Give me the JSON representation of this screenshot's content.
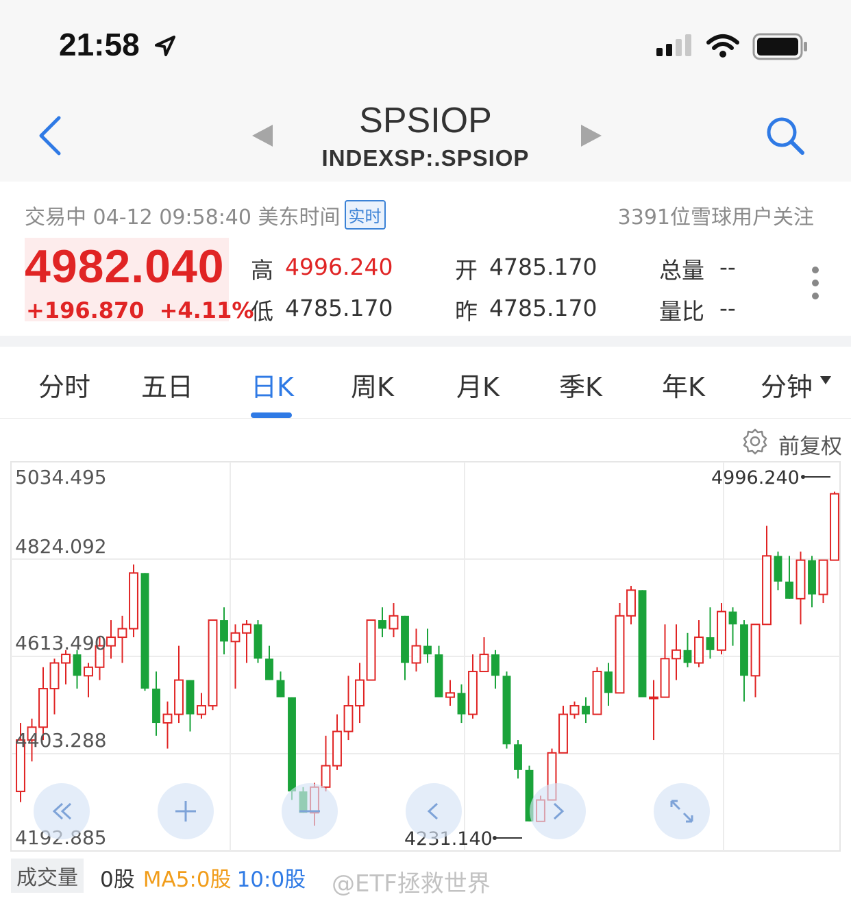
{
  "status_bar": {
    "time": "21:58"
  },
  "nav": {
    "title": "SPSIOP",
    "subtitle": "INDEXSP:.SPSIOP"
  },
  "quote": {
    "status": "交易中 04-12 09:58:40 美东时间",
    "realtime_badge": "实时",
    "followers": "3391位雪球用户关注",
    "price": "4982.040",
    "change": "+196.870",
    "change_pct": "+4.11%",
    "high_label": "高",
    "high": "4996.240",
    "low_label": "低",
    "low": "4785.170",
    "open_label": "开",
    "open": "4785.170",
    "prev_label": "昨",
    "prev_close": "4785.170",
    "volume_label": "总量",
    "volume": "--",
    "ratio_label": "量比",
    "ratio": "--",
    "price_color": "#e02424"
  },
  "tabs": {
    "items": [
      "分时",
      "五日",
      "日K",
      "周K",
      "月K",
      "季K",
      "年K",
      "分钟"
    ],
    "active": "日K"
  },
  "adjust_label": "前复权",
  "chart_data": {
    "type": "candlestick",
    "y_tick_labels": [
      "5034.495",
      "4824.092",
      "4613.490",
      "4403.288",
      "4192.885"
    ],
    "ylim": [
      4192.885,
      5034.495
    ],
    "max_label": "4996.240",
    "min_label": "4231.140",
    "up_color": "#e02424",
    "down_color": "#1aa33a",
    "candles": [
      [
        4300,
        4420,
        4275,
        4460
      ],
      [
        4420,
        4450,
        4370,
        4470
      ],
      [
        4450,
        4540,
        4420,
        4590
      ],
      [
        4540,
        4600,
        4480,
        4610
      ],
      [
        4600,
        4620,
        4550,
        4630
      ],
      [
        4620,
        4570,
        4540,
        4630
      ],
      [
        4570,
        4590,
        4520,
        4600
      ],
      [
        4590,
        4640,
        4560,
        4660
      ],
      [
        4640,
        4660,
        4610,
        4700
      ],
      [
        4660,
        4680,
        4600,
        4710
      ],
      [
        4680,
        4810,
        4660,
        4830
      ],
      [
        4810,
        4540,
        4535,
        4810
      ],
      [
        4540,
        4460,
        4430,
        4580
      ],
      [
        4460,
        4480,
        4400,
        4510
      ],
      [
        4480,
        4560,
        4460,
        4640
      ],
      [
        4560,
        4480,
        4440,
        4560
      ],
      [
        4480,
        4500,
        4470,
        4530
      ],
      [
        4500,
        4700,
        4490,
        4700
      ],
      [
        4700,
        4650,
        4620,
        4730
      ],
      [
        4650,
        4670,
        4540,
        4690
      ],
      [
        4670,
        4690,
        4600,
        4700
      ],
      [
        4690,
        4610,
        4600,
        4700
      ],
      [
        4610,
        4560,
        4560,
        4640
      ],
      [
        4560,
        4520,
        4520,
        4580
      ],
      [
        4520,
        4300,
        4280,
        4520
      ],
      [
        4300,
        4250,
        4250,
        4310
      ],
      [
        4250,
        4310,
        4220,
        4320
      ],
      [
        4310,
        4360,
        4300,
        4430
      ],
      [
        4360,
        4440,
        4350,
        4480
      ],
      [
        4440,
        4500,
        4420,
        4570
      ],
      [
        4500,
        4560,
        4460,
        4600
      ],
      [
        4560,
        4700,
        4560,
        4700
      ],
      [
        4700,
        4680,
        4660,
        4730
      ],
      [
        4680,
        4710,
        4660,
        4740
      ],
      [
        4710,
        4600,
        4560,
        4710
      ],
      [
        4600,
        4640,
        4580,
        4680
      ],
      [
        4640,
        4620,
        4600,
        4680
      ],
      [
        4620,
        4520,
        4520,
        4640
      ],
      [
        4520,
        4530,
        4500,
        4560
      ],
      [
        4530,
        4480,
        4460,
        4550
      ],
      [
        4480,
        4580,
        4470,
        4620
      ],
      [
        4580,
        4620,
        4580,
        4660
      ],
      [
        4620,
        4570,
        4540,
        4630
      ],
      [
        4570,
        4410,
        4400,
        4580
      ],
      [
        4410,
        4350,
        4330,
        4420
      ],
      [
        4350,
        4230,
        4230,
        4360
      ],
      [
        4230,
        4280,
        4230,
        4290
      ],
      [
        4280,
        4390,
        4280,
        4400
      ],
      [
        4390,
        4480,
        4390,
        4500
      ],
      [
        4480,
        4500,
        4470,
        4510
      ],
      [
        4500,
        4480,
        4460,
        4520
      ],
      [
        4480,
        4580,
        4480,
        4590
      ],
      [
        4580,
        4530,
        4500,
        4600
      ],
      [
        4530,
        4710,
        4530,
        4740
      ],
      [
        4710,
        4770,
        4690,
        4780
      ],
      [
        4770,
        4520,
        4520,
        4770
      ],
      [
        4520,
        4520,
        4420,
        4560
      ],
      [
        4520,
        4610,
        4520,
        4690
      ],
      [
        4610,
        4630,
        4560,
        4690
      ],
      [
        4630,
        4600,
        4590,
        4670
      ],
      [
        4600,
        4660,
        4590,
        4700
      ],
      [
        4660,
        4630,
        4610,
        4730
      ],
      [
        4630,
        4720,
        4620,
        4740
      ],
      [
        4720,
        4690,
        4640,
        4730
      ],
      [
        4690,
        4570,
        4510,
        4700
      ],
      [
        4570,
        4690,
        4520,
        4690
      ],
      [
        4690,
        4850,
        4690,
        4920
      ],
      [
        4850,
        4790,
        4770,
        4860
      ],
      [
        4790,
        4750,
        4750,
        4850
      ],
      [
        4750,
        4840,
        4690,
        4860
      ],
      [
        4840,
        4760,
        4730,
        4850
      ],
      [
        4760,
        4840,
        4740,
        4840
      ],
      [
        4840,
        4995,
        4840,
        5000
      ]
    ]
  },
  "volume": {
    "label": "成交量",
    "total": "0股",
    "ma5": "MA5:0股",
    "ma10": "10:0股"
  },
  "watermark": "@ETF拯救世界"
}
